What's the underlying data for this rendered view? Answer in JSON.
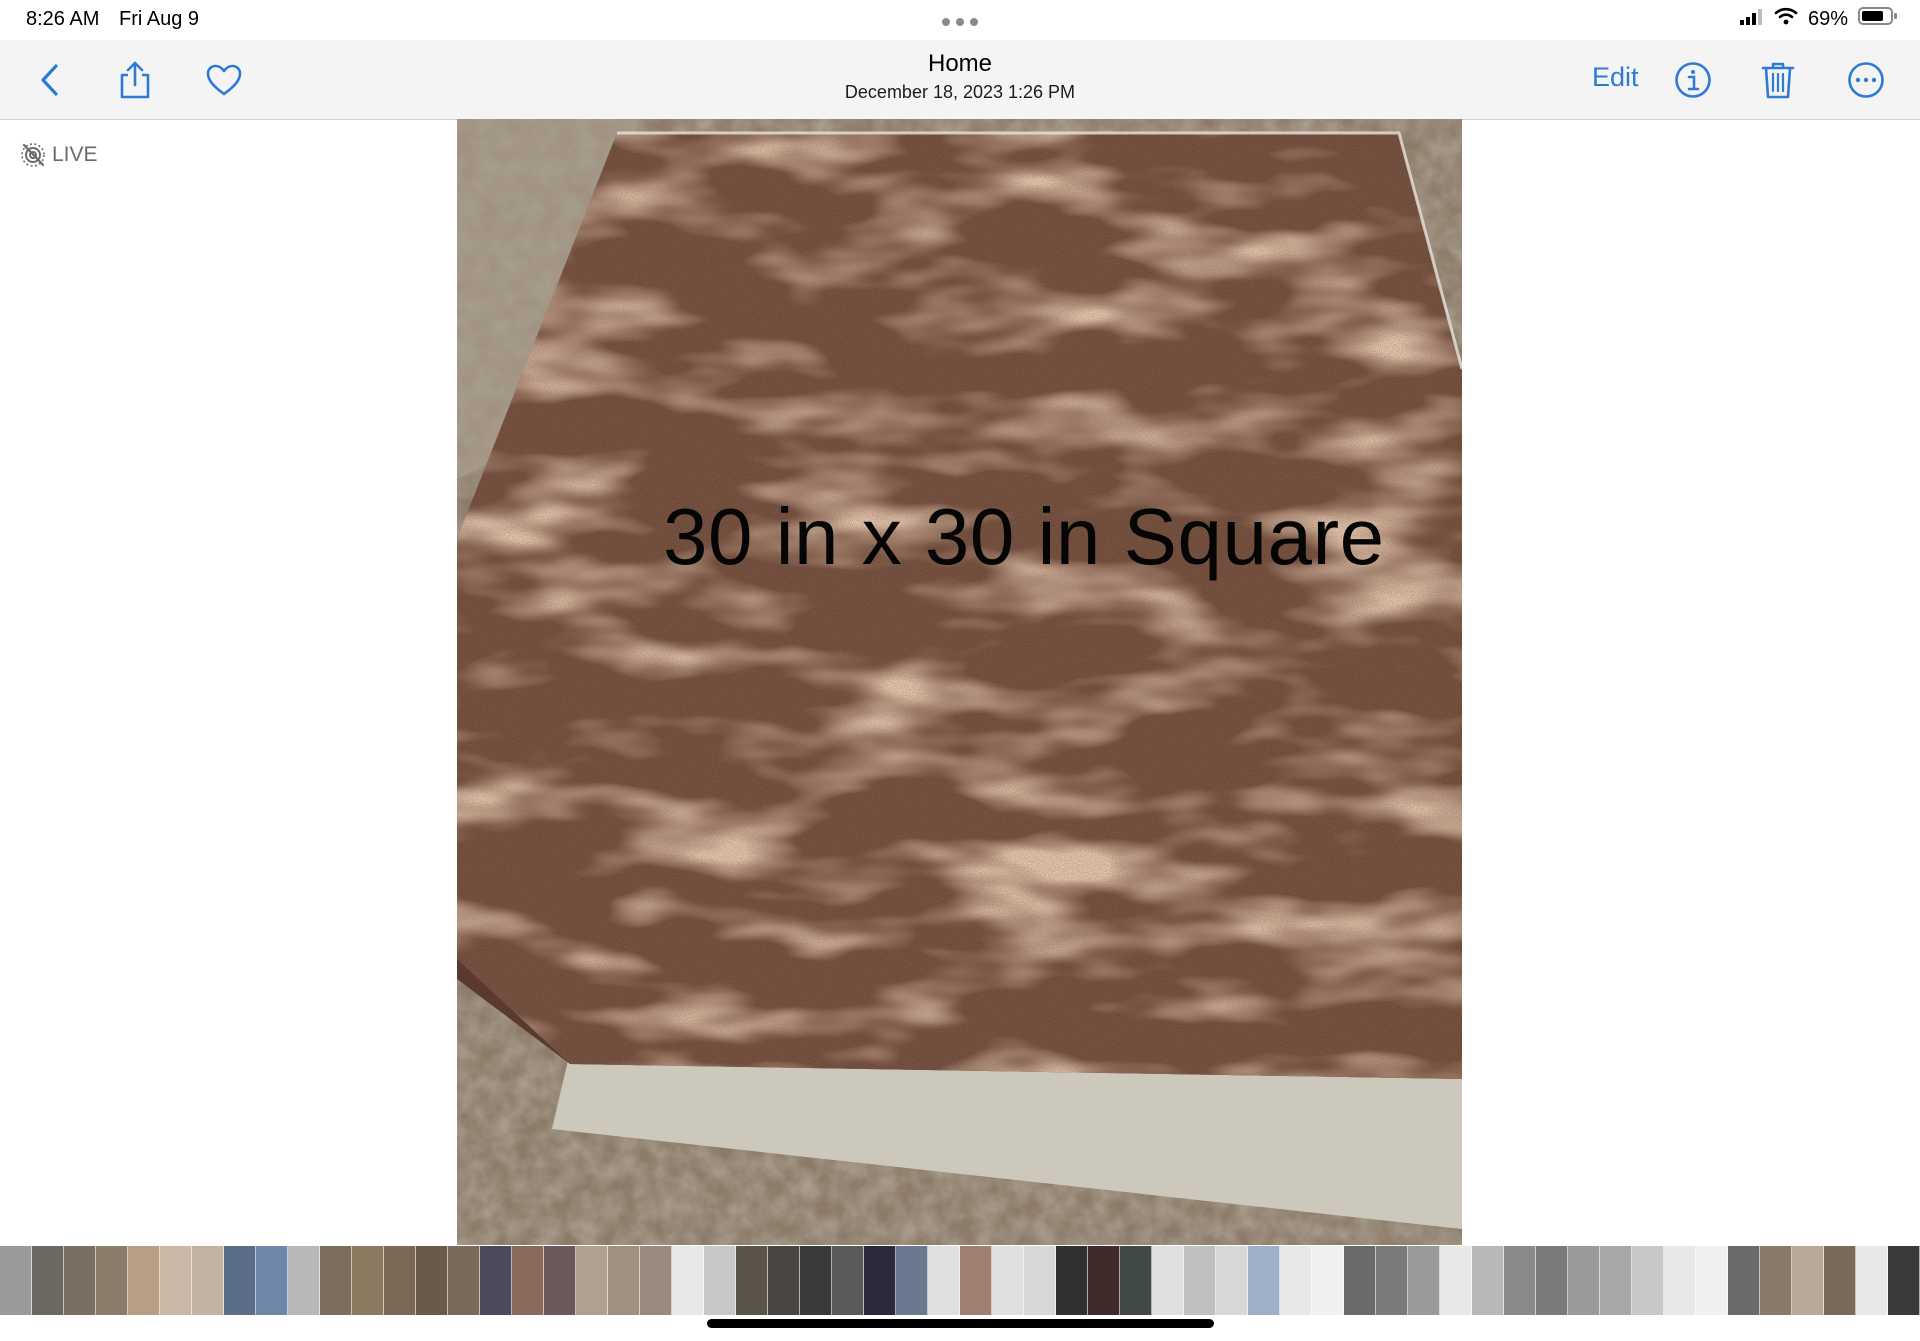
{
  "status_bar": {
    "time": "8:26 AM",
    "date": "Fri Aug 9",
    "battery": "69%"
  },
  "nav": {
    "title": "Home",
    "subtitle": "December 18, 2023  1:26 PM",
    "edit_label": "Edit"
  },
  "live_badge": {
    "label": "LIVE"
  },
  "photo": {
    "caption": "30 in x 30 in Square"
  },
  "colors": {
    "accent": "#2e7bd6",
    "granite_dark": "#4a2d23",
    "granite_mid": "#7a4e3c",
    "granite_light": "#d8a27c"
  },
  "filmstrip": {
    "thumbnails": [
      "#9a9a9a",
      "#6c6a60",
      "#7a6f62",
      "#8a7d6a",
      "#b89e84",
      "#c9b8a6",
      "#c2b3a3",
      "#5a6e8a",
      "#6e86a8",
      "#b8b8b8",
      "#7c6e5e",
      "#8a7a60",
      "#7a6a55",
      "#6a5a4a",
      "#7a6a5a",
      "#4a4a5a",
      "#8a6a5a",
      "#6a5a5a",
      "#b0a090",
      "#a09080",
      "#9a8a80",
      "#e8e8e8",
      "#c8c8c8",
      "#5a5548",
      "#4a4540",
      "#3a3a3a",
      "#5a5a5a",
      "#2a2a3a",
      "#6a7890",
      "#e0e0e0",
      "#a08070",
      "#e0e0e0",
      "#d8d8d8",
      "#303030",
      "#402a2a",
      "#404848",
      "#e0e0e0",
      "#c0c0c0",
      "#d8d8d8",
      "#a0b0c8",
      "#e8e8e8",
      "#f0f0f0",
      "#6a6a6a",
      "#7a7a7a",
      "#9a9a9a",
      "#e8e8e8",
      "#b8b8b8",
      "#8a8a8a",
      "#7a7a7a",
      "#9a9a9a",
      "#a8a8a8",
      "#c8c8c8",
      "#e8e8e8",
      "#f0f0f0",
      "#6a6a6a",
      "#8a7a6a",
      "#b8a898",
      "#7a6a5a",
      "#e8e8e8",
      "#3a3a3a"
    ]
  }
}
